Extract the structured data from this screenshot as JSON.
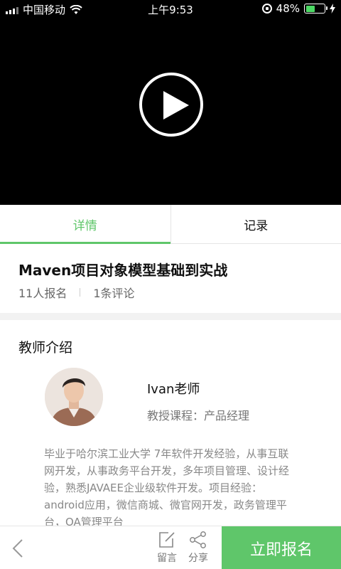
{
  "status_bar": {
    "carrier": "中国移动",
    "time": "上午9:53",
    "battery_text": "48%",
    "battery_level": 0.48,
    "battery_color": "#4cd964"
  },
  "video": {
    "play_icon": "play-icon"
  },
  "tabs": [
    {
      "label": "详情",
      "active": true
    },
    {
      "label": "记录",
      "active": false
    }
  ],
  "course": {
    "title": "Maven项目对象模型基础到实战",
    "enrolled": "11人报名",
    "comments": "1条评论"
  },
  "teacher": {
    "section_title": "教师介绍",
    "name": "Ivan老师",
    "course": "教授课程：产品经理",
    "bio": "毕业于哈尔滨工业大学 7年软件开发经验，从事互联网开发，从事政务平台开发，多年项目管理、设计经验，熟悉JAVAEE企业级软件开发。项目经验：android应用，微信商城、微官网开发，政务管理平台，OA管理平台"
  },
  "bottom_bar": {
    "comment_label": "留言",
    "share_label": "分享",
    "signup_label": "立即报名",
    "accent_color": "#5fc66a"
  }
}
